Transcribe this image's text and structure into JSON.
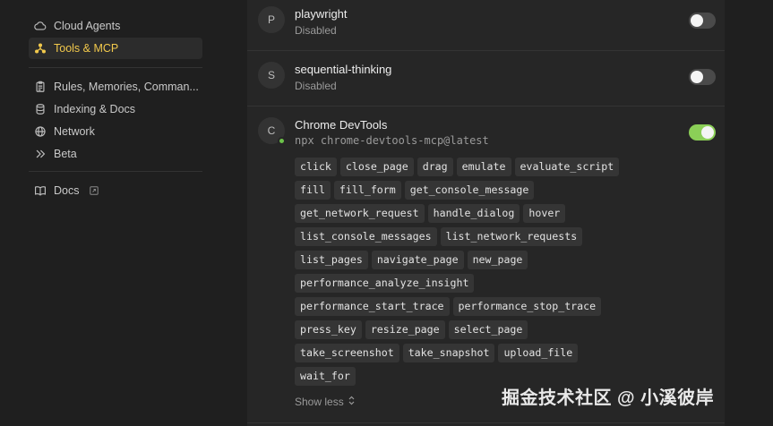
{
  "sidebar": {
    "items": [
      {
        "label": "Cloud Agents",
        "icon": "cloud-icon",
        "active": false
      },
      {
        "label": "Tools & MCP",
        "icon": "tools-icon",
        "active": true
      },
      {
        "label": "Rules, Memories, Comman...",
        "icon": "clipboard-icon",
        "active": false
      },
      {
        "label": "Indexing & Docs",
        "icon": "database-icon",
        "active": false
      },
      {
        "label": "Network",
        "icon": "globe-icon",
        "active": false
      },
      {
        "label": "Beta",
        "icon": "chevrons-right-icon",
        "active": false
      },
      {
        "label": "Docs",
        "icon": "book-icon",
        "active": false
      }
    ],
    "accent_color": "#f2c94c"
  },
  "servers": [
    {
      "initial": "P",
      "name": "playwright",
      "status": "Disabled",
      "enabled": false
    },
    {
      "initial": "S",
      "name": "sequential-thinking",
      "status": "Disabled",
      "enabled": false
    },
    {
      "initial": "C",
      "name": "Chrome DevTools",
      "command": "npx chrome-devtools-mcp@latest",
      "enabled": true,
      "tools": [
        "click",
        "close_page",
        "drag",
        "emulate",
        "evaluate_script",
        "fill",
        "fill_form",
        "get_console_message",
        "get_network_request",
        "handle_dialog",
        "hover",
        "list_console_messages",
        "list_network_requests",
        "list_pages",
        "navigate_page",
        "new_page",
        "performance_analyze_insight",
        "performance_start_trace",
        "performance_stop_trace",
        "press_key",
        "resize_page",
        "select_page",
        "take_screenshot",
        "take_snapshot",
        "upload_file",
        "wait_for"
      ],
      "show_less_label": "Show less"
    }
  ],
  "colors": {
    "toggle_on": "#8bcf57",
    "toggle_off": "#4a4a4a",
    "status_dot": "#6cc24a"
  },
  "watermark": "掘金技术社区 @ 小溪彼岸"
}
